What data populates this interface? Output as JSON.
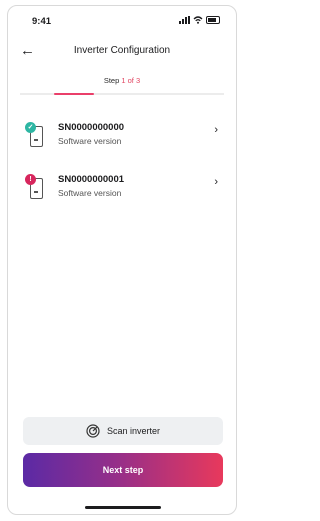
{
  "status": {
    "time": "9:41"
  },
  "header": {
    "title": "Inverter Configuration"
  },
  "step": {
    "prefix": "Step",
    "current": "1 of 3",
    "progress": 0.33
  },
  "devices": [
    {
      "serial": "SN0000000000",
      "subtitle": "Software version",
      "status": "ok",
      "badge": "✓"
    },
    {
      "serial": "SN0000000001",
      "subtitle": "Software version",
      "status": "error",
      "badge": "!"
    }
  ],
  "actions": {
    "scan_label": "Scan inverter",
    "next_label": "Next step"
  },
  "colors": {
    "accent": "#ea3f6a",
    "ok": "#2db6a3",
    "error": "#d7265d",
    "gradient_start": "#5b2aa5",
    "gradient_end": "#e8395c"
  }
}
